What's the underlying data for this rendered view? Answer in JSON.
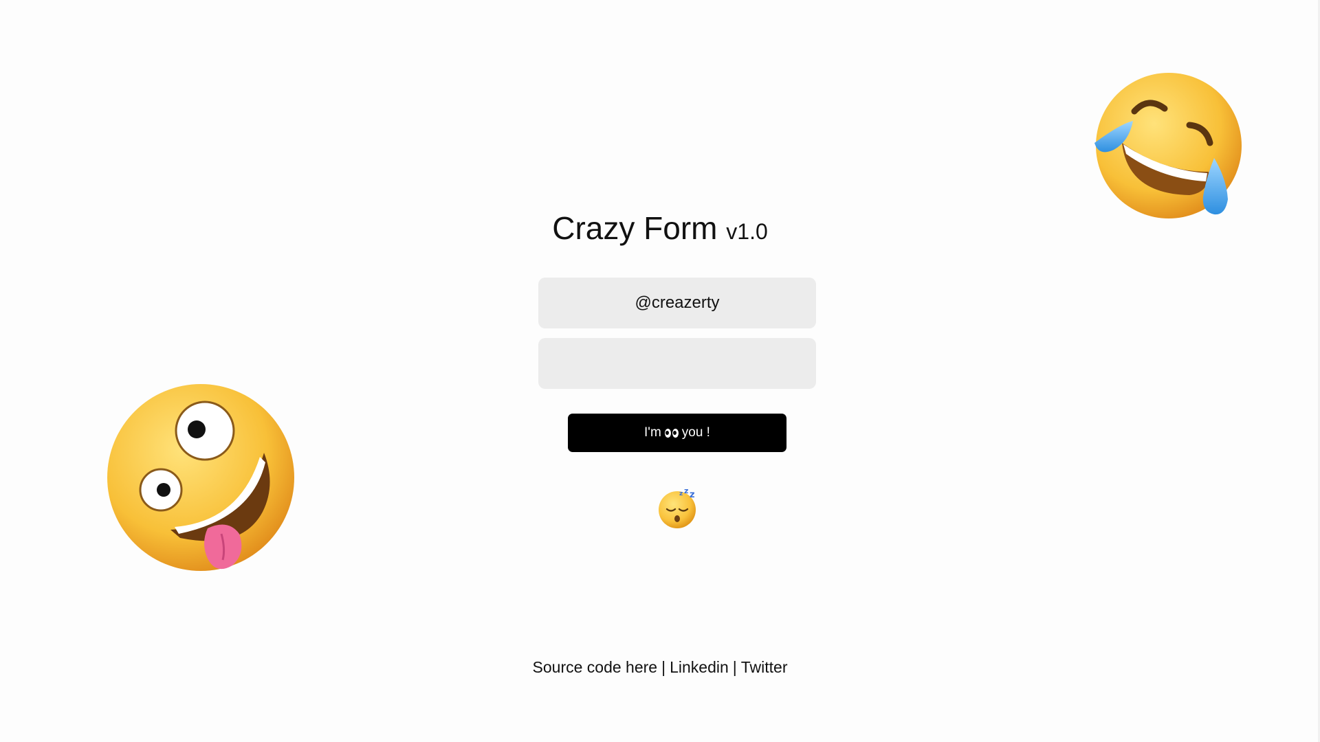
{
  "header": {
    "title": "Crazy Form",
    "version": "v1.0"
  },
  "form": {
    "username_value": "@creazerty",
    "password_value": "",
    "submit_prefix": "I'm",
    "submit_suffix": "you !"
  },
  "footer": {
    "source_label": "Source code here",
    "linkedin_label": "Linkedin",
    "twitter_label": "Twitter",
    "separator": "|"
  },
  "decorations": {
    "left_emoji": "zany-face-icon",
    "right_emoji": "rolling-on-floor-laughing-icon",
    "status_emoji": "sleeping-face-icon"
  },
  "colors": {
    "background": "#fdfdfd",
    "field": "#ececec",
    "button": "#000000",
    "button_text": "#ffffff"
  }
}
